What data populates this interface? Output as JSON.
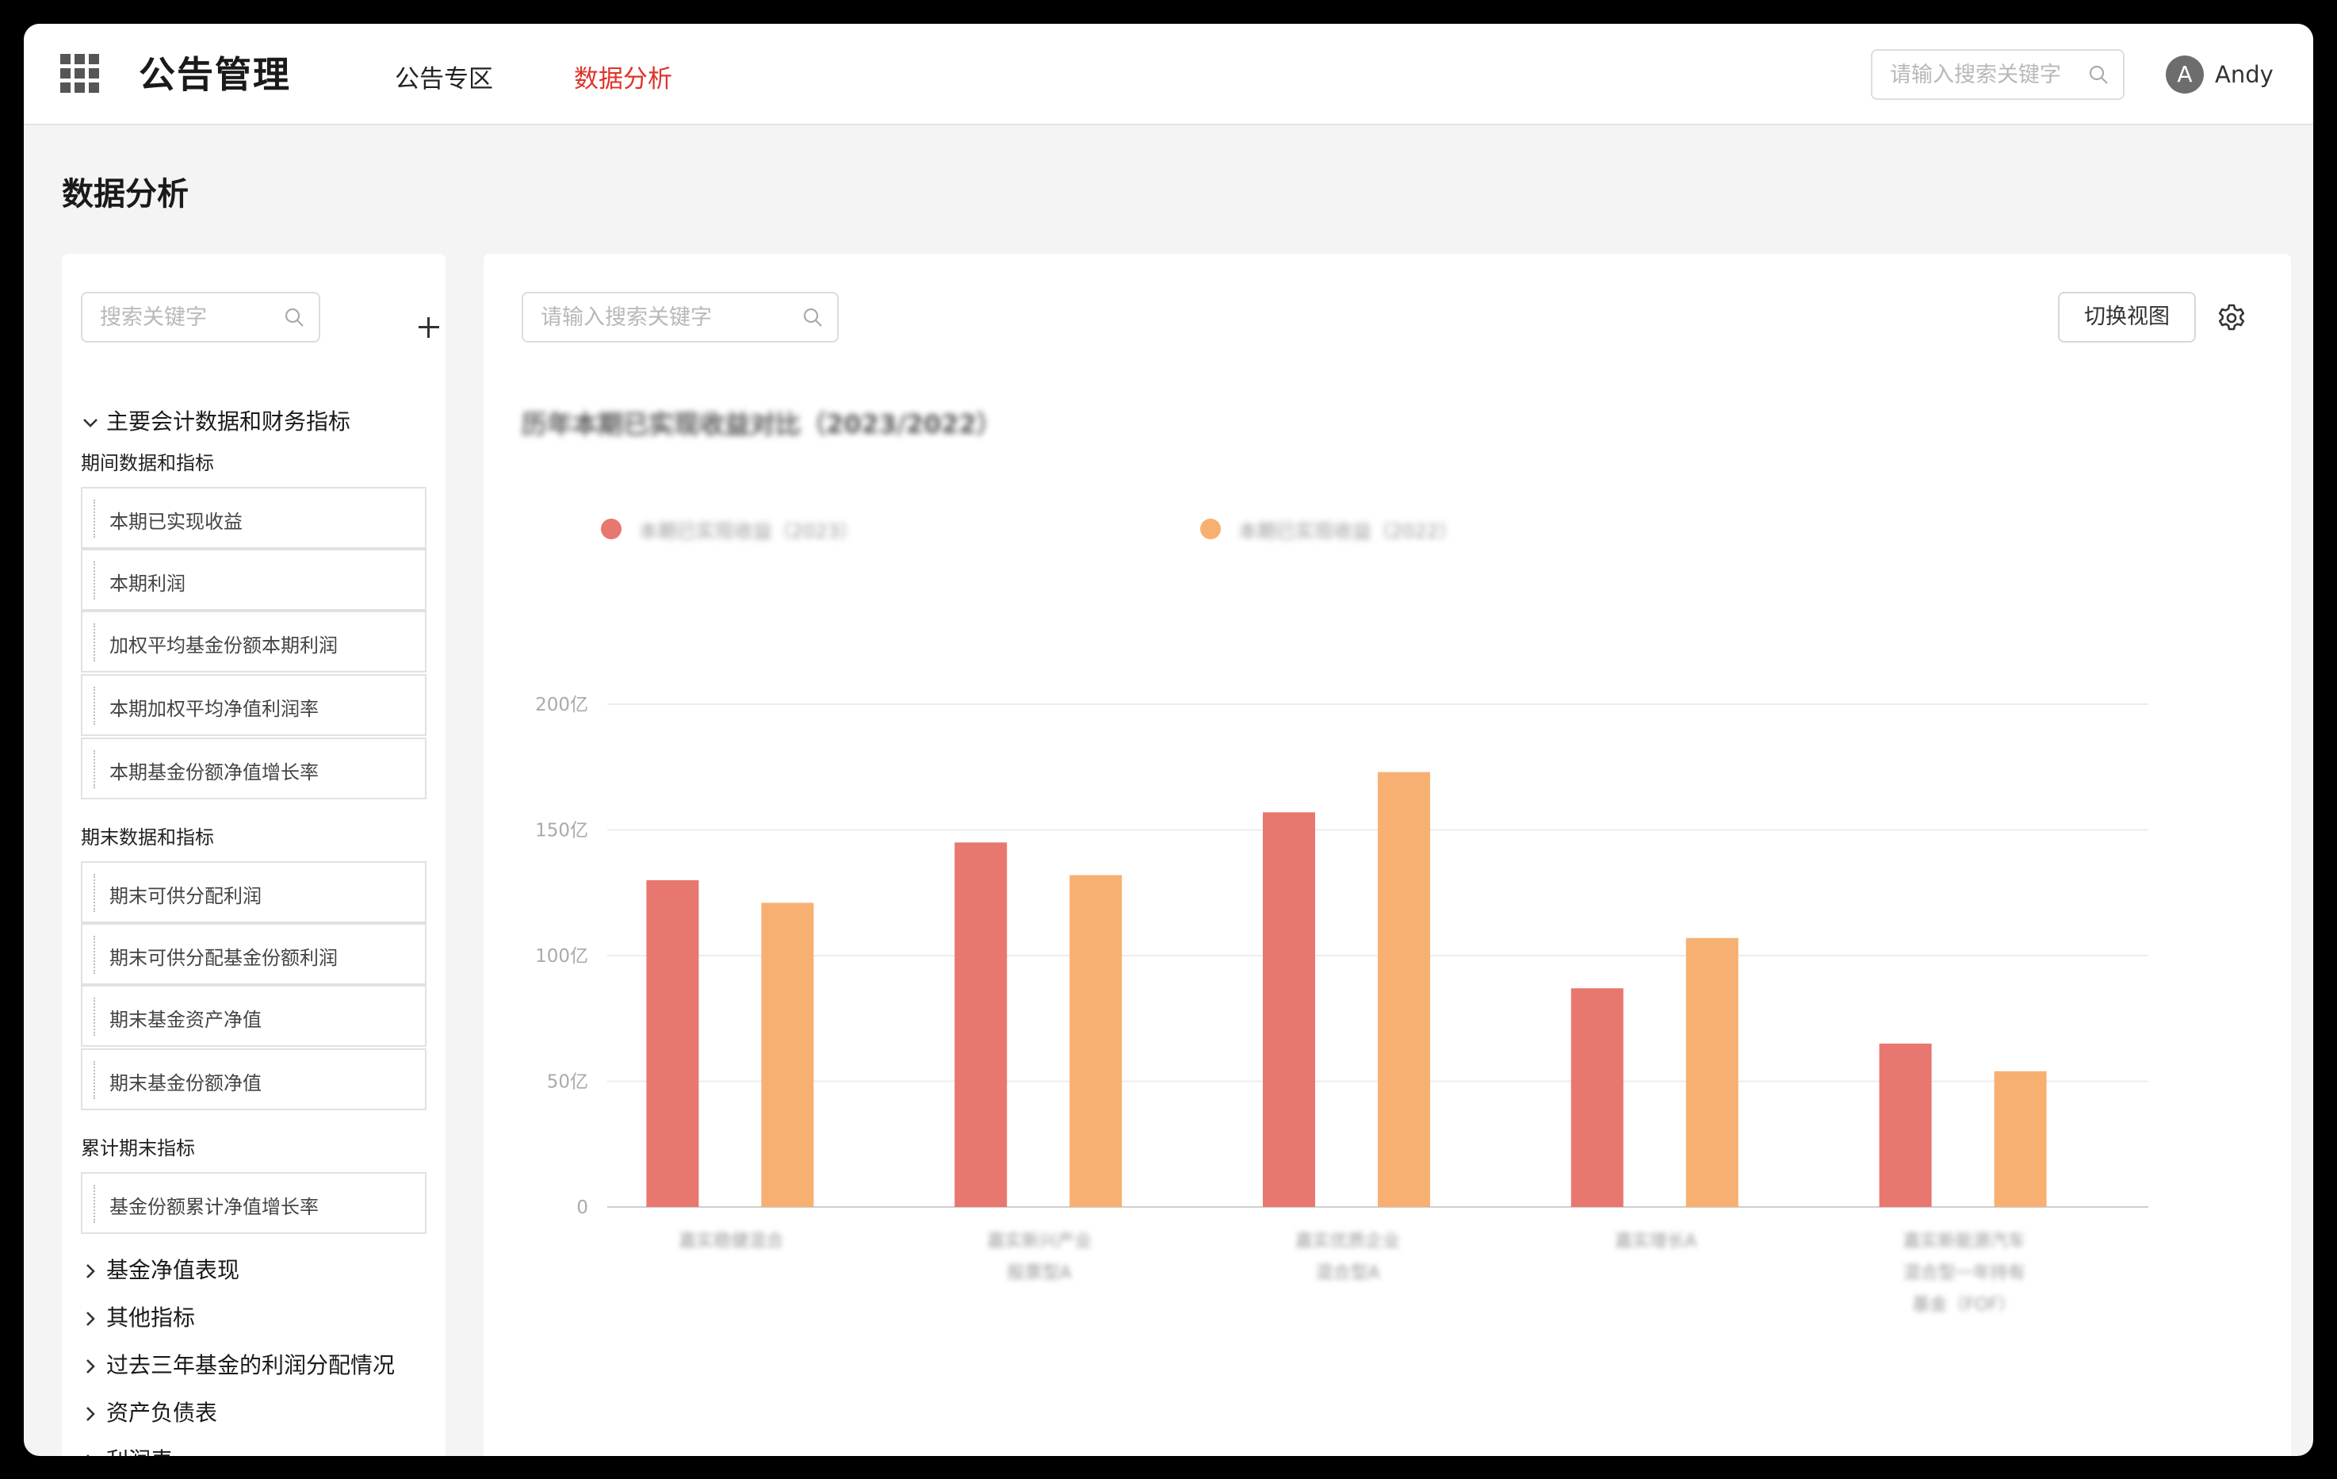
{
  "header": {
    "app_title": "公告管理",
    "tabs": [
      {
        "label": "公告专区",
        "active": false
      },
      {
        "label": "数据分析",
        "active": true
      }
    ],
    "search_placeholder": "请输入搜索关键字",
    "user": {
      "initial": "A",
      "name": "Andy"
    }
  },
  "page_title": "数据分析",
  "sidebar": {
    "search_placeholder": "搜索关键字",
    "groups": [
      {
        "label": "主要会计数据和财务指标",
        "expanded": true,
        "sections": [
          {
            "label": "期间数据和指标",
            "items": [
              "本期已实现收益",
              "本期利润",
              "加权平均基金份额本期利润",
              "本期加权平均净值利润率",
              "本期基金份额净值增长率"
            ]
          },
          {
            "label": "期末数据和指标",
            "items": [
              "期末可供分配利润",
              "期末可供分配基金份额利润",
              "期末基金资产净值",
              "期末基金份额净值"
            ]
          },
          {
            "label": "累计期末指标",
            "items": [
              "基金份额累计净值增长率"
            ]
          }
        ]
      },
      {
        "label": "基金净值表现",
        "expanded": false
      },
      {
        "label": "其他指标",
        "expanded": false
      },
      {
        "label": "过去三年基金的利润分配情况",
        "expanded": false
      },
      {
        "label": "资产负债表",
        "expanded": false
      },
      {
        "label": "利润表",
        "expanded": false
      }
    ]
  },
  "main": {
    "search_placeholder": "请输入搜索关键字",
    "switch_view_label": "切换视图"
  },
  "colors": {
    "accent": "#e0332b",
    "series_2023": "#e8776f",
    "series_2022": "#f7b072"
  },
  "chart_data": {
    "type": "bar",
    "title": "历年本期已实现收益对比（2023/2022）",
    "yticks": [
      "0",
      "50亿",
      "100亿",
      "150亿",
      "200亿"
    ],
    "ylim": [
      0,
      200
    ],
    "categories": [
      [
        "嘉实稳健混合"
      ],
      [
        "嘉实新兴产业",
        "股票型A"
      ],
      [
        "嘉实优质企业",
        "混合型A"
      ],
      [
        "嘉实增长A"
      ],
      [
        "嘉实新能源汽车",
        "混合型一年持有",
        "基金（FOF）"
      ]
    ],
    "series": [
      {
        "name": "本期已实现收益（2023）",
        "values": [
          130,
          145,
          157,
          87,
          65
        ]
      },
      {
        "name": "本期已实现收益（2022）",
        "values": [
          121,
          132,
          173,
          107,
          54
        ]
      }
    ],
    "grid": true,
    "legend": "top-left"
  }
}
